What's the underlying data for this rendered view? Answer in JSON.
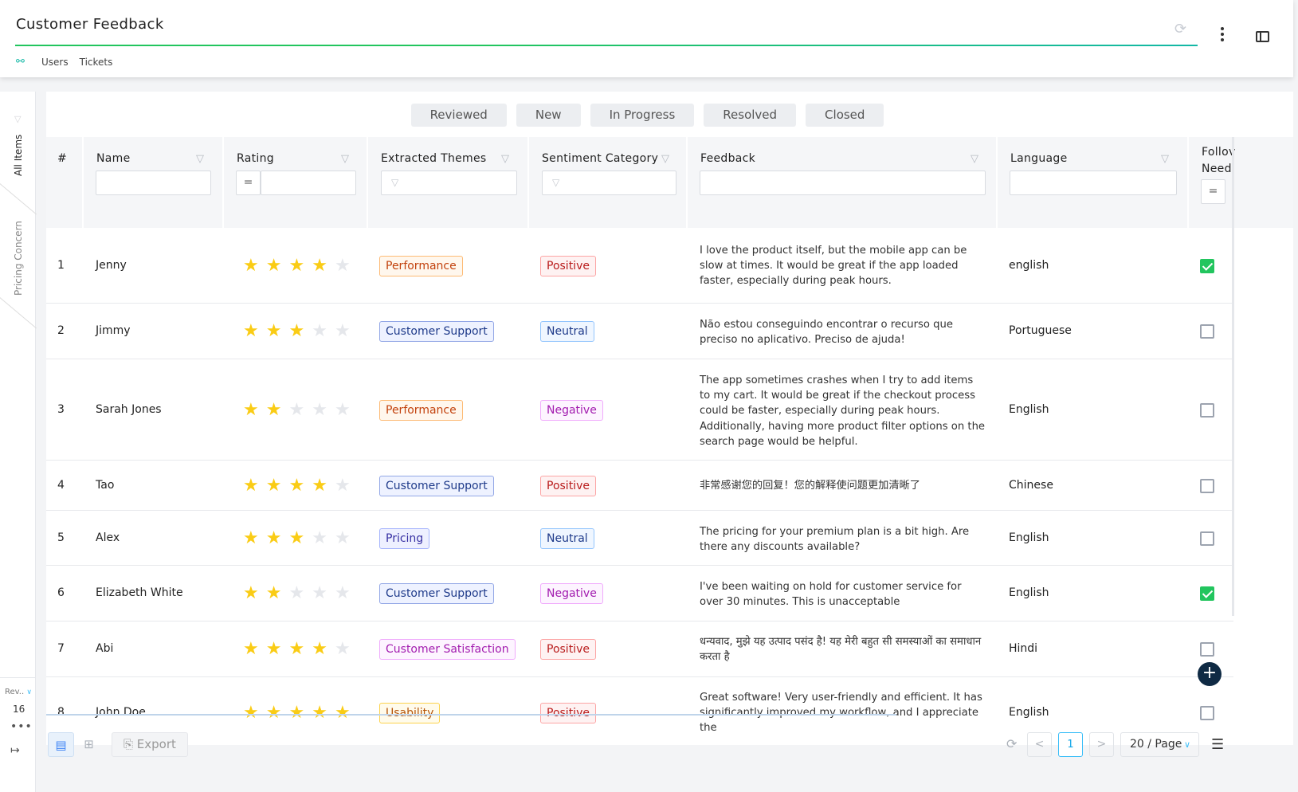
{
  "header": {
    "title": "Customer Feedback",
    "breadcrumbs": [
      "Users",
      "Tickets"
    ]
  },
  "rail": {
    "tabs": [
      "All Items",
      "Pricing Concern"
    ],
    "rev_label": "Rev..",
    "rev_count": "16"
  },
  "status_tabs": [
    "Reviewed",
    "New",
    "In Progress",
    "Resolved",
    "Closed"
  ],
  "columns": {
    "index": "#",
    "name": "Name",
    "rating": "Rating",
    "themes": "Extracted Themes",
    "sentiment": "Sentiment Category",
    "feedback": "Feedback",
    "language": "Language",
    "followup_line1": "Follov",
    "followup_line2": "Need"
  },
  "filters": {
    "rating_operator": "=",
    "followup_operator": "="
  },
  "rows": [
    {
      "index": "1",
      "name": "Jenny",
      "rating": 4,
      "theme": "Performance",
      "sentiment": "Positive",
      "feedback": "I love the product itself, but the mobile app can be slow at times. It would be great if the app loaded faster, especially during peak hours.",
      "language": "english",
      "followup": true
    },
    {
      "index": "2",
      "name": "Jimmy",
      "rating": 3,
      "theme": "Customer Support",
      "sentiment": "Neutral",
      "feedback": "Não estou conseguindo encontrar o recurso que preciso no aplicativo. Preciso de ajuda!",
      "language": "Portuguese",
      "followup": false
    },
    {
      "index": "3",
      "name": "Sarah Jones",
      "rating": 2,
      "theme": "Performance",
      "sentiment": "Negative",
      "feedback": "The app sometimes crashes when I try to add items to my cart. It would be great if the checkout process could be faster, especially during peak hours. Additionally, having more product filter options on the search page would be helpful.",
      "language": "English",
      "followup": false
    },
    {
      "index": "4",
      "name": "Tao",
      "rating": 4,
      "theme": "Customer Support",
      "sentiment": "Positive",
      "feedback": "非常感谢您的回复！您的解释使问题更加清晰了",
      "language": "Chinese",
      "followup": false
    },
    {
      "index": "5",
      "name": "Alex",
      "rating": 3,
      "theme": "Pricing",
      "sentiment": "Neutral",
      "feedback": "The pricing for your premium plan is a bit high. Are there any discounts available?",
      "language": "English",
      "followup": false
    },
    {
      "index": "6",
      "name": "Elizabeth White",
      "rating": 2,
      "theme": "Customer Support",
      "sentiment": "Negative",
      "feedback": "I've been waiting on hold for customer service for over 30 minutes. This is unacceptable",
      "language": "English",
      "followup": true
    },
    {
      "index": "7",
      "name": "Abi",
      "rating": 4,
      "theme": "Customer Satisfaction",
      "sentiment": "Positive",
      "feedback": "धन्यवाद, मुझे यह उत्पाद पसंद है! यह मेरी बहुत सी समस्याओं का समाधान करता है",
      "language": "Hindi",
      "followup": false
    },
    {
      "index": "8",
      "name": "John Doe",
      "rating": 5,
      "theme": "Usability",
      "sentiment": "Positive",
      "feedback": "Great software! Very user-friendly and efficient. It has significantly improved my workflow, and I appreciate the",
      "language": "English",
      "followup": false
    }
  ],
  "footer": {
    "export_label": "Export",
    "prev": "<",
    "current_page": "1",
    "next": ">",
    "page_size": "20 / Page"
  },
  "colors": {
    "accent": "#14b8a6",
    "theme_tags": {
      "Performance": {
        "fg": "#c2410c",
        "bg": "#fff7ed",
        "border": "#fdba74"
      },
      "Customer Support": {
        "fg": "#1e3a8a",
        "bg": "#eef2ff",
        "border": "#93a7e6"
      },
      "Pricing": {
        "fg": "#3730a3",
        "bg": "#eef0ff",
        "border": "#a5b4fc"
      },
      "Customer Satisfaction": {
        "fg": "#a21caf",
        "bg": "#fdf4ff",
        "border": "#f0abfc"
      },
      "Usability": {
        "fg": "#b45309",
        "bg": "#fffbeb",
        "border": "#fcd34d"
      }
    },
    "sentiment_tags": {
      "Positive": {
        "fg": "#b91c1c",
        "bg": "#fef2f2",
        "border": "#fca5a5"
      },
      "Neutral": {
        "fg": "#1e3a8a",
        "bg": "#eff6ff",
        "border": "#93c5fd"
      },
      "Negative": {
        "fg": "#a21caf",
        "bg": "#fdf4ff",
        "border": "#f0abfc"
      }
    }
  }
}
